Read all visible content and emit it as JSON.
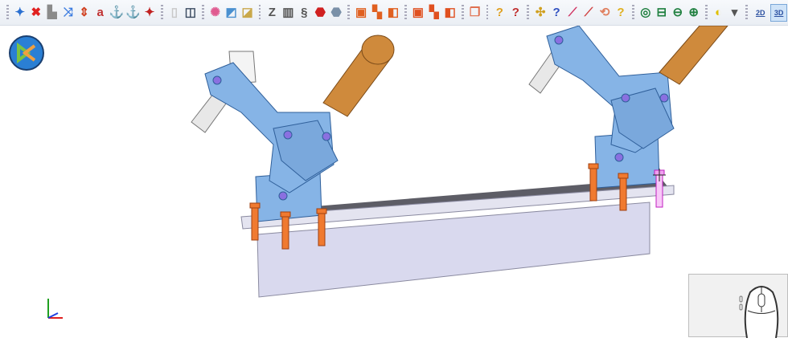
{
  "toolbar": {
    "groups": [
      [
        {
          "name": "add-constraint-icon",
          "c": "#2a6fd0",
          "g": "✦"
        },
        {
          "name": "delete-constraint-icon",
          "c": "#e02020",
          "g": "✖"
        },
        {
          "name": "fix-part-icon",
          "c": "#8a8a8a",
          "g": "▙"
        },
        {
          "name": "move-part-icon",
          "c": "#3b7be0",
          "g": "⤨"
        },
        {
          "name": "flip-icon",
          "c": "#d04020",
          "g": "⇕"
        },
        {
          "name": "annotate-icon",
          "c": "#c03030",
          "g": "a"
        },
        {
          "name": "anchor-icon",
          "c": "#c0202a",
          "g": "⚓"
        },
        {
          "name": "multi-anchor-icon",
          "c": "#c08020",
          "g": "⚓"
        },
        {
          "name": "constraint-tree-icon",
          "c": "#c02020",
          "g": "✦"
        }
      ],
      [
        {
          "name": "book-icon",
          "c": "#c8c8c8",
          "g": "▯"
        },
        {
          "name": "cube-outline-icon",
          "c": "#3a4a60",
          "g": "◫"
        }
      ],
      [
        {
          "name": "color-palette-icon",
          "c": "#e05a90",
          "g": "✺"
        },
        {
          "name": "section-view-icon",
          "c": "#4a90d0",
          "g": "◩"
        },
        {
          "name": "shaded-box-icon",
          "c": "#c9a84a",
          "g": "◪"
        }
      ],
      [
        {
          "name": "spring-icon",
          "c": "#555",
          "g": "Z"
        },
        {
          "name": "hatch-icon",
          "c": "#555",
          "g": "▥"
        },
        {
          "name": "thread-icon",
          "c": "#555",
          "g": "§"
        },
        {
          "name": "red-solid-icon",
          "c": "#d02020",
          "g": "⬣"
        },
        {
          "name": "gray-solid-icon",
          "c": "#7a90a8",
          "g": "⬣"
        }
      ],
      [
        {
          "name": "add-component-icon",
          "c": "#e06020",
          "g": "▣"
        },
        {
          "name": "remove-component-icon",
          "c": "#e06020",
          "g": "▚"
        },
        {
          "name": "replace-component-icon",
          "c": "#e06020",
          "g": "◧"
        }
      ],
      [
        {
          "name": "insert-part-icon",
          "c": "#e05020",
          "g": "▣"
        },
        {
          "name": "remove-part-icon",
          "c": "#e05020",
          "g": "▚"
        },
        {
          "name": "pattern-part-icon",
          "c": "#e05020",
          "g": "◧"
        }
      ],
      [
        {
          "name": "overlap-icon",
          "c": "#e07050",
          "g": "❐"
        }
      ],
      [
        {
          "name": "query-part-icon",
          "c": "#e0a020",
          "g": "?"
        },
        {
          "name": "query-dimension-icon",
          "c": "#c03030",
          "g": "?"
        }
      ],
      [
        {
          "name": "interference-icon",
          "c": "#d0a020",
          "g": "✣"
        },
        {
          "name": "query-distance-icon",
          "c": "#3050c0",
          "g": "?"
        },
        {
          "name": "measure-angle-icon",
          "c": "#d03060",
          "g": "⟋"
        },
        {
          "name": "measure-edge-icon",
          "c": "#d04040",
          "g": "⟋"
        },
        {
          "name": "measure-face-icon",
          "c": "#e08060",
          "g": "⟲"
        },
        {
          "name": "query-volume-icon",
          "c": "#e0b020",
          "g": "?"
        }
      ],
      [
        {
          "name": "zoom-fit-icon",
          "c": "#208040",
          "g": "◎"
        },
        {
          "name": "zoom-window-icon",
          "c": "#208040",
          "g": "⊟"
        },
        {
          "name": "zoom-previous-icon",
          "c": "#208040",
          "g": "⊖"
        },
        {
          "name": "zoom-next-icon",
          "c": "#208040",
          "g": "⊕"
        }
      ],
      [
        {
          "name": "center-of-gravity-icon",
          "c": "#e0c000",
          "g": "◐"
        },
        {
          "name": "dropdown-arrow-icon",
          "c": "#555",
          "g": "▾"
        }
      ]
    ],
    "view_2d_label": "2D",
    "view_3d_label": "3D"
  },
  "colors": {
    "clamp_blue": "#86b4e6",
    "clamp_outline": "#2f5f9a",
    "handle_orange": "#cf8a3c",
    "screw_orange": "#f07a30",
    "screw_selected": "#e040d0",
    "plate": "#d9d9ee"
  }
}
